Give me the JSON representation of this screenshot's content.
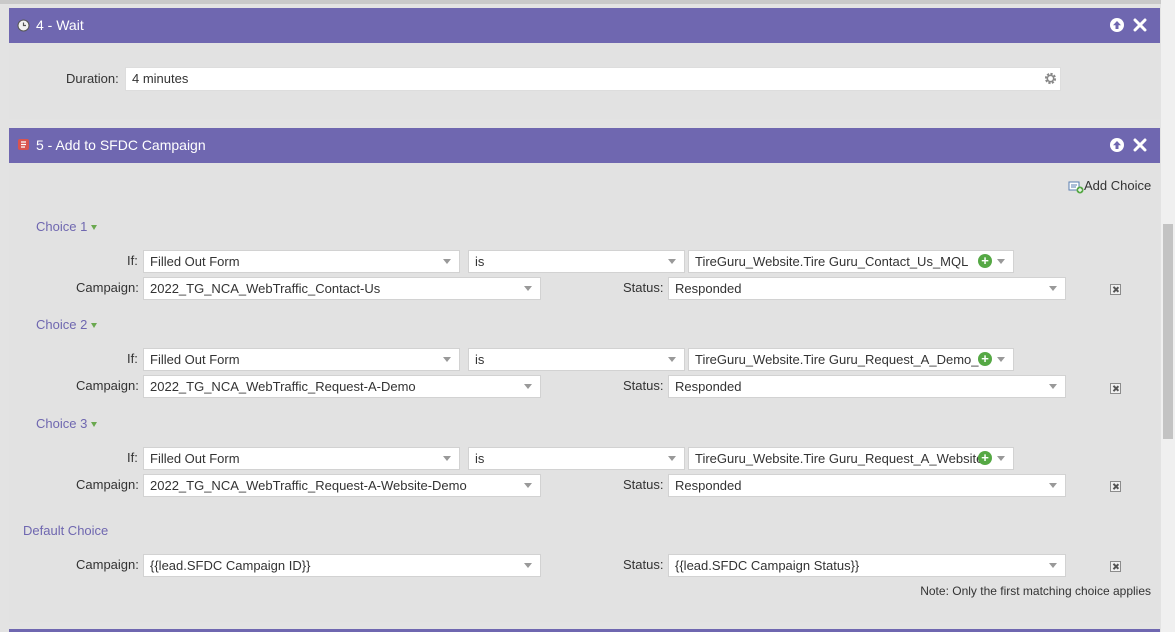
{
  "wait_step": {
    "title": "4 - Wait",
    "duration_label": "Duration:",
    "duration_value": "4 minutes"
  },
  "sfdc_step": {
    "title": "5 - Add to SFDC Campaign",
    "add_choice_label": "Add Choice",
    "choices": [
      {
        "label": "Choice 1",
        "if_label": "If:",
        "if_value": "Filled Out Form",
        "operator": "is",
        "form": "TireGuru_Website.Tire Guru_Contact_Us_MQL",
        "campaign_label": "Campaign:",
        "campaign": "2022_TG_NCA_WebTraffic_Contact-Us",
        "status_label": "Status:",
        "status": "Responded"
      },
      {
        "label": "Choice 2",
        "if_label": "If:",
        "if_value": "Filled Out Form",
        "operator": "is",
        "form": "TireGuru_Website.Tire Guru_Request_A_Demo_",
        "campaign_label": "Campaign:",
        "campaign": "2022_TG_NCA_WebTraffic_Request-A-Demo",
        "status_label": "Status:",
        "status": "Responded"
      },
      {
        "label": "Choice 3",
        "if_label": "If:",
        "if_value": "Filled Out Form",
        "operator": "is",
        "form": "TireGuru_Website.Tire Guru_Request_A_Website",
        "campaign_label": "Campaign:",
        "campaign": "2022_TG_NCA_WebTraffic_Request-A-Website-Demo",
        "status_label": "Status:",
        "status": "Responded"
      }
    ],
    "default_choice": {
      "label": "Default Choice",
      "campaign_label": "Campaign:",
      "campaign": "{{lead.SFDC Campaign ID}}",
      "status_label": "Status:",
      "status": "{{lead.SFDC Campaign Status}}"
    },
    "note": "Note: Only the first matching choice applies"
  },
  "colors": {
    "header_bar": "#6f67b0",
    "choice_label": "#6f67b0",
    "add_icon": "#55a844"
  }
}
